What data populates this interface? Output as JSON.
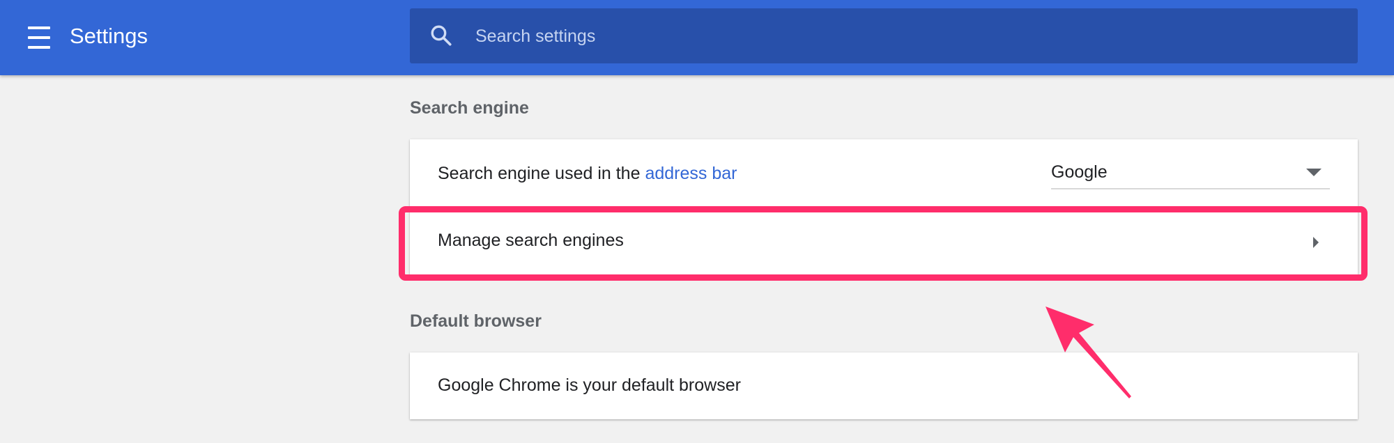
{
  "header": {
    "title": "Settings",
    "menu_icon": "hamburger-menu-icon",
    "search_icon": "search-icon",
    "search_placeholder": "Search settings",
    "background_color": "#3367d6"
  },
  "sections": {
    "search_engine": {
      "title": "Search engine",
      "row_used_prefix": "Search engine used in the ",
      "row_used_link": "address bar",
      "selected_engine": "Google",
      "manage_label": "Manage search engines"
    },
    "default_browser": {
      "title": "Default browser",
      "status": "Google Chrome is your default browser"
    }
  },
  "annotation": {
    "highlight_color": "#ff2d6b",
    "target": "Manage search engines"
  }
}
